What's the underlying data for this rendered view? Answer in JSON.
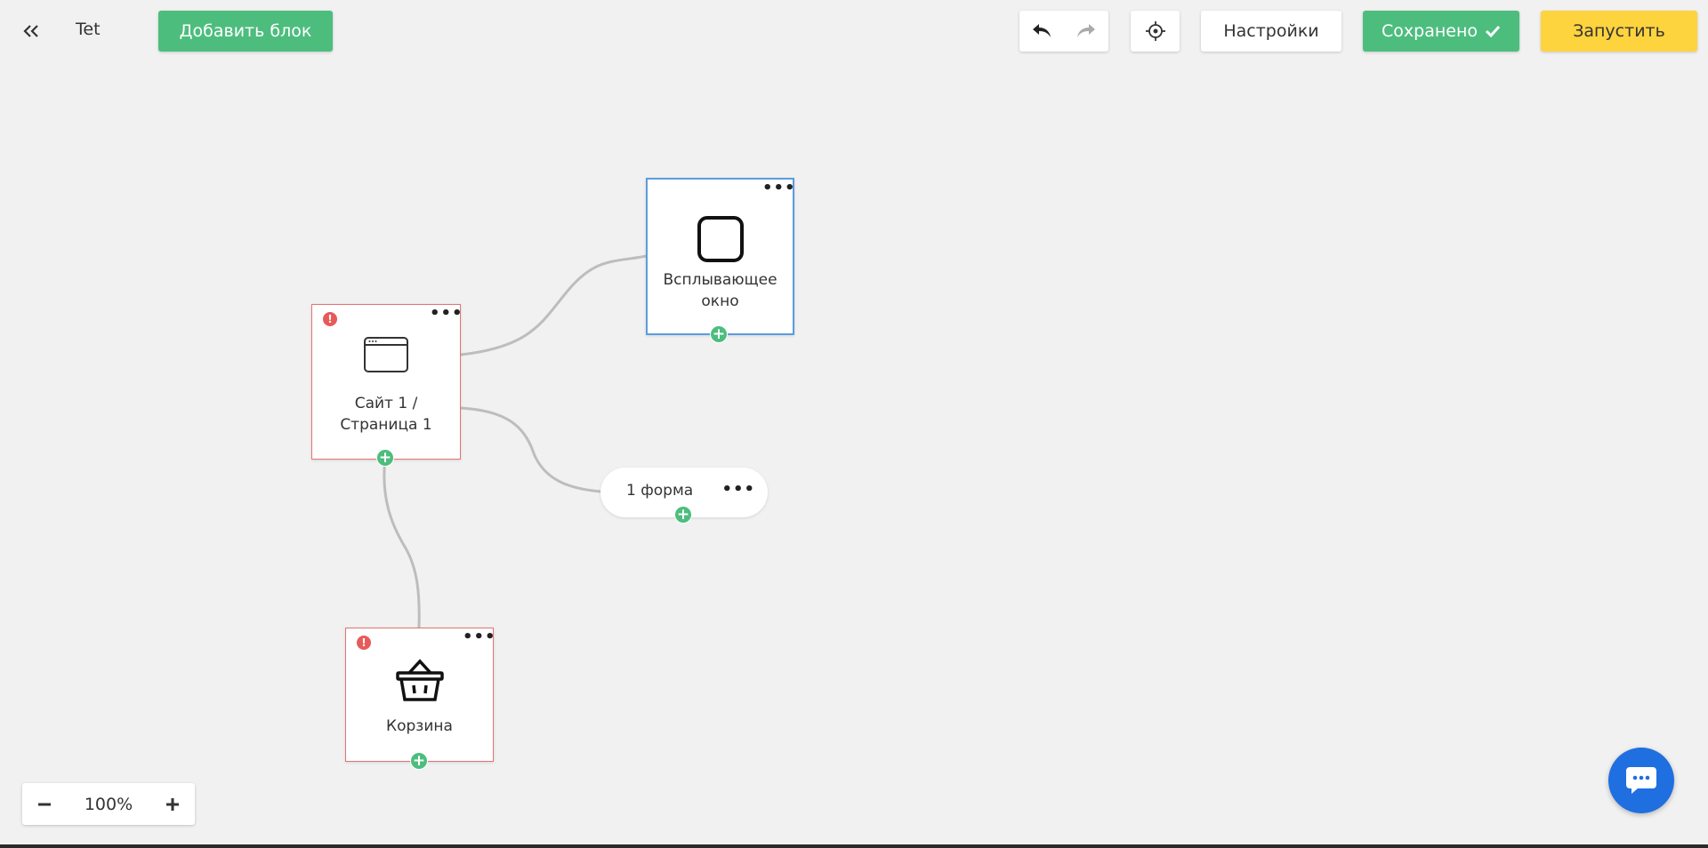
{
  "header": {
    "back_icon": "double-chevron-left-icon",
    "project_name": "Tet",
    "add_block_label": "Добавить блок",
    "undo_icon": "undo-icon",
    "redo_icon": "redo-icon",
    "locate_icon": "crosshair-icon",
    "settings_label": "Настройки",
    "saved_label": "Сохранено",
    "saved_icon": "check-icon",
    "launch_label": "Запустить"
  },
  "nodes": {
    "site": {
      "label_line1": "Сайт 1 /",
      "label_line2": "Страница 1",
      "icon": "browser-window-icon",
      "error": "!"
    },
    "popup": {
      "label_line1": "Всплывающее",
      "label_line2": "окно",
      "icon": "rounded-square-icon"
    },
    "cart": {
      "label": "Корзина",
      "icon": "basket-icon",
      "error": "!"
    },
    "form": {
      "label": "1 форма"
    }
  },
  "zoom": {
    "level": "100%"
  },
  "colors": {
    "green": "#4dbd7e",
    "yellow": "#fdd33e",
    "error": "#e85a5a",
    "selected_border": "#5a9de0",
    "chat": "#1f6fe0"
  }
}
